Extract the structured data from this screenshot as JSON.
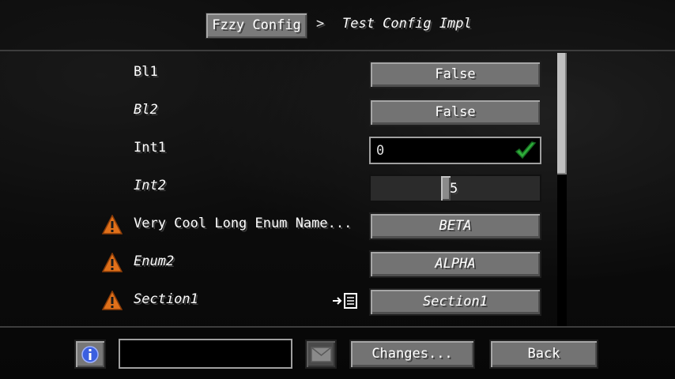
{
  "header": {
    "breadcrumb_root": "Fzzy Config",
    "breadcrumb_separator": ">",
    "breadcrumb_current": "Test Config Impl"
  },
  "settings": [
    {
      "label": "Bl1",
      "italic": false,
      "warning": false,
      "control": "button",
      "value": "False"
    },
    {
      "label": "Bl2",
      "italic": true,
      "warning": false,
      "control": "button",
      "value": "False"
    },
    {
      "label": "Int1",
      "italic": false,
      "warning": false,
      "control": "field",
      "value": "0",
      "valid": true
    },
    {
      "label": "Int2",
      "italic": true,
      "warning": false,
      "control": "slider",
      "value": "5"
    },
    {
      "label": "Very Cool Long Enum Name...",
      "italic": false,
      "warning": true,
      "control": "button",
      "value": "BETA",
      "value_italic": true
    },
    {
      "label": "Enum2",
      "italic": true,
      "warning": true,
      "control": "button",
      "value": "ALPHA",
      "value_italic": true
    },
    {
      "label": "Section1",
      "italic": true,
      "warning": true,
      "control": "button",
      "value": "Section1",
      "value_italic": true,
      "goto_icon": true
    }
  ],
  "footer": {
    "info_icon": "info-icon",
    "search_value": "",
    "mail_icon": "mail-icon",
    "changes_label": "Changes...",
    "back_label": "Back"
  },
  "colors": {
    "button": "#737373",
    "warning": "#e0701a",
    "check": "#2fae3a",
    "info": "#3b5fe0"
  }
}
